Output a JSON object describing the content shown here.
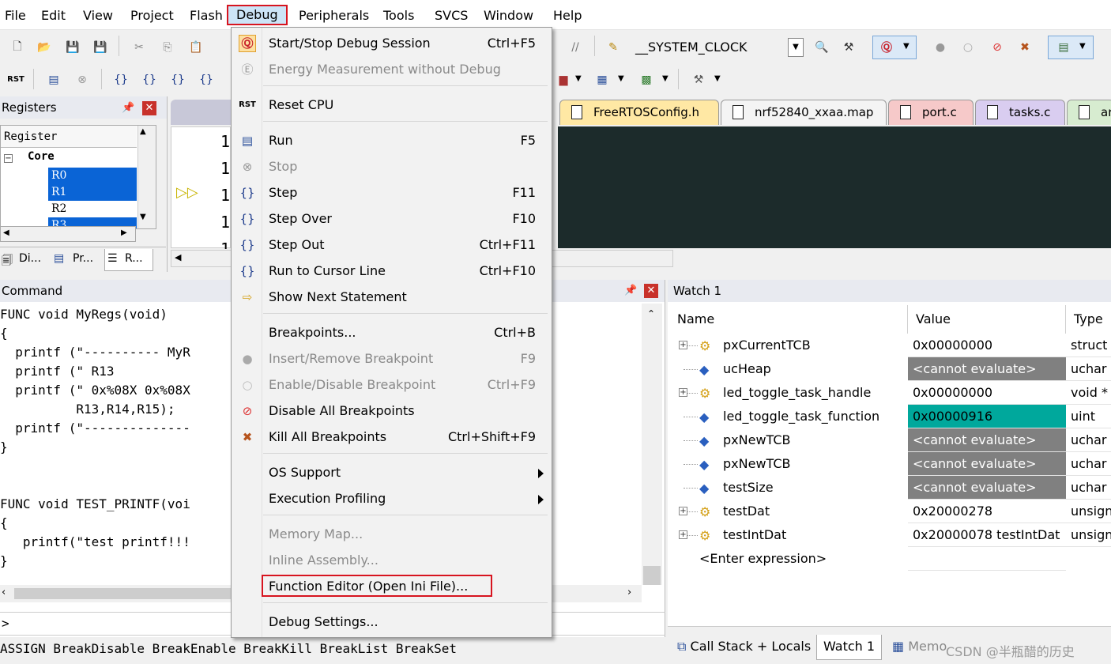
{
  "menubar": {
    "items": [
      "File",
      "Edit",
      "View",
      "Project",
      "Flash",
      "Debug",
      "Peripherals",
      "Tools",
      "SVCS",
      "Window",
      "Help"
    ]
  },
  "toolbar": {
    "clock_combo": "__SYSTEM_CLOCK"
  },
  "registers": {
    "title": "Registers",
    "col_header": "Register",
    "group": "Core",
    "items": [
      "R0",
      "R1",
      "R2",
      "R3"
    ],
    "tabs": [
      "Di...",
      "Pr...",
      "R..."
    ]
  },
  "editor": {
    "line_numbers": [
      "1",
      "1",
      "1",
      "1",
      "1"
    ],
    "tabs": [
      "FreeRTOSConfig.h",
      "nrf52840_xxaa.map",
      "port.c",
      "tasks.c",
      "ar"
    ],
    "tab_colors": [
      "#ffe8a4",
      "#f4f4f4",
      "#f6c9c9",
      "#d9cdf0",
      "#d7ecd0"
    ],
    "code_bg": "#1c2b2b"
  },
  "command": {
    "title": "Command",
    "lines": [
      "FUNC void MyRegs(void)",
      "{",
      "  printf (\"---------- MyR",
      "  printf (\" R13",
      "  printf (\" 0x%08X 0x%08X",
      "          R13,R14,R15);",
      "  printf (\"--------------",
      "}",
      "",
      "",
      "FUNC void TEST_PRINTF(voi",
      "{",
      "   printf(\"test printf!!!",
      "}"
    ],
    "prompt": ">",
    "status": "ASSIGN BreakDisable BreakEnable BreakKill BreakList BreakSet"
  },
  "watch": {
    "title": "Watch 1",
    "columns": [
      "Name",
      "Value",
      "Type"
    ],
    "rows": [
      {
        "name": "pxCurrentTCB",
        "value": "0x00000000",
        "type": "struct t",
        "expand": true,
        "bg": "#ffffff"
      },
      {
        "name": "ucHeap",
        "value": "<cannot evaluate>",
        "type": "uchar",
        "expand": false,
        "bg": "#808080"
      },
      {
        "name": "led_toggle_task_handle",
        "value": "0x00000000",
        "type": "void *",
        "expand": true,
        "bg": "#ffffff"
      },
      {
        "name": "led_toggle_task_function",
        "value": "0x00000916",
        "type": "uint",
        "expand": false,
        "bg": "#00a89c"
      },
      {
        "name": "pxNewTCB",
        "value": "<cannot evaluate>",
        "type": "uchar",
        "expand": false,
        "bg": "#808080"
      },
      {
        "name": "pxNewTCB",
        "value": "<cannot evaluate>",
        "type": "uchar",
        "expand": false,
        "bg": "#808080"
      },
      {
        "name": "testSize",
        "value": "<cannot evaluate>",
        "type": "uchar",
        "expand": false,
        "bg": "#808080"
      },
      {
        "name": "testDat",
        "value": "0x20000278",
        "type": "unsign",
        "expand": true,
        "bg": "#ffffff"
      },
      {
        "name": "testIntDat",
        "value": "0x20000078 testIntDat",
        "type": "unsign",
        "expand": true,
        "bg": "#ffffff"
      }
    ],
    "enter_expression": "<Enter expression>",
    "bottom_tabs": [
      "Call Stack + Locals",
      "Watch 1",
      "Memo"
    ],
    "watermark": "CSDN @半瓶醋的历史"
  },
  "debug_menu": {
    "items": [
      {
        "label": "Start/Stop Debug Session",
        "shortcut": "Ctrl+F5",
        "icon": "debug-session-icon",
        "disabled": false
      },
      {
        "label": "Energy Measurement without Debug",
        "shortcut": "",
        "icon": "energy-icon",
        "disabled": true
      },
      {
        "label": "Reset CPU",
        "shortcut": "",
        "icon": "reset-icon",
        "disabled": false
      },
      {
        "label": "Run",
        "shortcut": "F5",
        "icon": "run-icon",
        "disabled": false
      },
      {
        "label": "Stop",
        "shortcut": "",
        "icon": "stop-icon",
        "disabled": true
      },
      {
        "label": "Step",
        "shortcut": "F11",
        "icon": "step-icon",
        "disabled": false
      },
      {
        "label": "Step Over",
        "shortcut": "F10",
        "icon": "step-over-icon",
        "disabled": false
      },
      {
        "label": "Step Out",
        "shortcut": "Ctrl+F11",
        "icon": "step-out-icon",
        "disabled": false
      },
      {
        "label": "Run to Cursor Line",
        "shortcut": "Ctrl+F10",
        "icon": "run-to-cursor-icon",
        "disabled": false
      },
      {
        "label": "Show Next Statement",
        "shortcut": "",
        "icon": "next-statement-icon",
        "disabled": false
      },
      {
        "label": "Breakpoints...",
        "shortcut": "Ctrl+B",
        "icon": "",
        "disabled": false
      },
      {
        "label": "Insert/Remove Breakpoint",
        "shortcut": "F9",
        "icon": "breakpoint-icon",
        "disabled": true
      },
      {
        "label": "Enable/Disable Breakpoint",
        "shortcut": "Ctrl+F9",
        "icon": "breakpoint-toggle-icon",
        "disabled": true
      },
      {
        "label": "Disable All Breakpoints",
        "shortcut": "",
        "icon": "disable-breakpoints-icon",
        "disabled": false
      },
      {
        "label": "Kill All Breakpoints",
        "shortcut": "Ctrl+Shift+F9",
        "icon": "kill-breakpoints-icon",
        "disabled": false
      },
      {
        "label": "OS Support",
        "shortcut": "",
        "icon": "",
        "disabled": false
      },
      {
        "label": "Execution Profiling",
        "shortcut": "",
        "icon": "",
        "disabled": false
      },
      {
        "label": "Memory Map...",
        "shortcut": "",
        "icon": "",
        "disabled": true
      },
      {
        "label": "Inline Assembly...",
        "shortcut": "",
        "icon": "",
        "disabled": true
      },
      {
        "label": "Function Editor (Open Ini File)...",
        "shortcut": "",
        "icon": "",
        "disabled": false
      },
      {
        "label": "Debug Settings...",
        "shortcut": "",
        "icon": "",
        "disabled": false
      }
    ]
  }
}
